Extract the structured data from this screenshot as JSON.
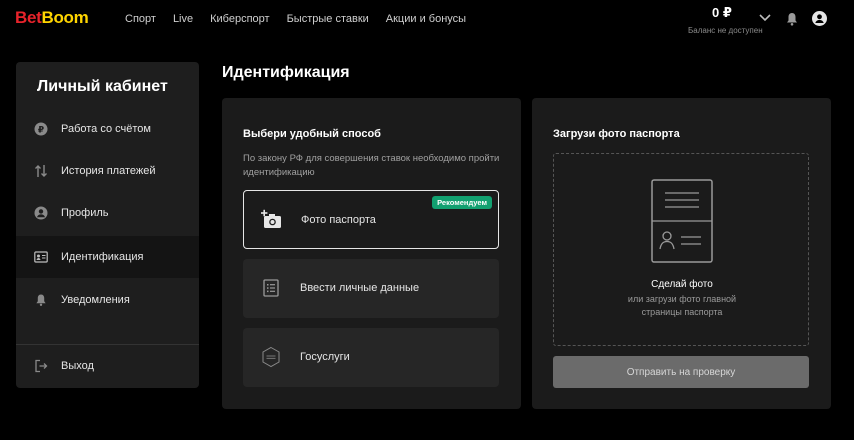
{
  "header": {
    "logo_bet": "Bet",
    "logo_boom": "Boom",
    "nav": [
      "Спорт",
      "Live",
      "Киберспорт",
      "Быстрые ставки",
      "Акции и бонусы"
    ],
    "balance": "0 ₽",
    "balance_note": "Баланс не доступен"
  },
  "sidebar": {
    "title": "Личный кабинет",
    "items": [
      {
        "label": "Работа со счётом",
        "icon": "ruble-icon"
      },
      {
        "label": "История платежей",
        "icon": "transfer-arrows-icon"
      },
      {
        "label": "Профиль",
        "icon": "user-icon"
      },
      {
        "label": "Идентификация",
        "icon": "id-card-icon"
      },
      {
        "label": "Уведомления",
        "icon": "bell-icon"
      }
    ],
    "logout": "Выход"
  },
  "page": {
    "title": "Идентификация"
  },
  "method_card": {
    "heading": "Выбери удобный способ",
    "description": "По закону РФ для совершения ставок необходимо пройти идентификацию",
    "options": [
      {
        "label": "Фото паспорта",
        "icon": "add-photo-icon",
        "badge": "Рекомендуем"
      },
      {
        "label": "Ввести личные данные",
        "icon": "list-icon"
      },
      {
        "label": "Госуслуги",
        "icon": "gosuslugi-icon"
      }
    ]
  },
  "upload_card": {
    "heading": "Загрузи фото паспорта",
    "cta": "Сделай фото",
    "sub": "или загрузи фото главной страницы паспорта",
    "submit": "Отправить на проверку"
  },
  "colors": {
    "brand_red": "#e8232b",
    "brand_yellow": "#ffd500",
    "badge_green": "#12a070"
  }
}
